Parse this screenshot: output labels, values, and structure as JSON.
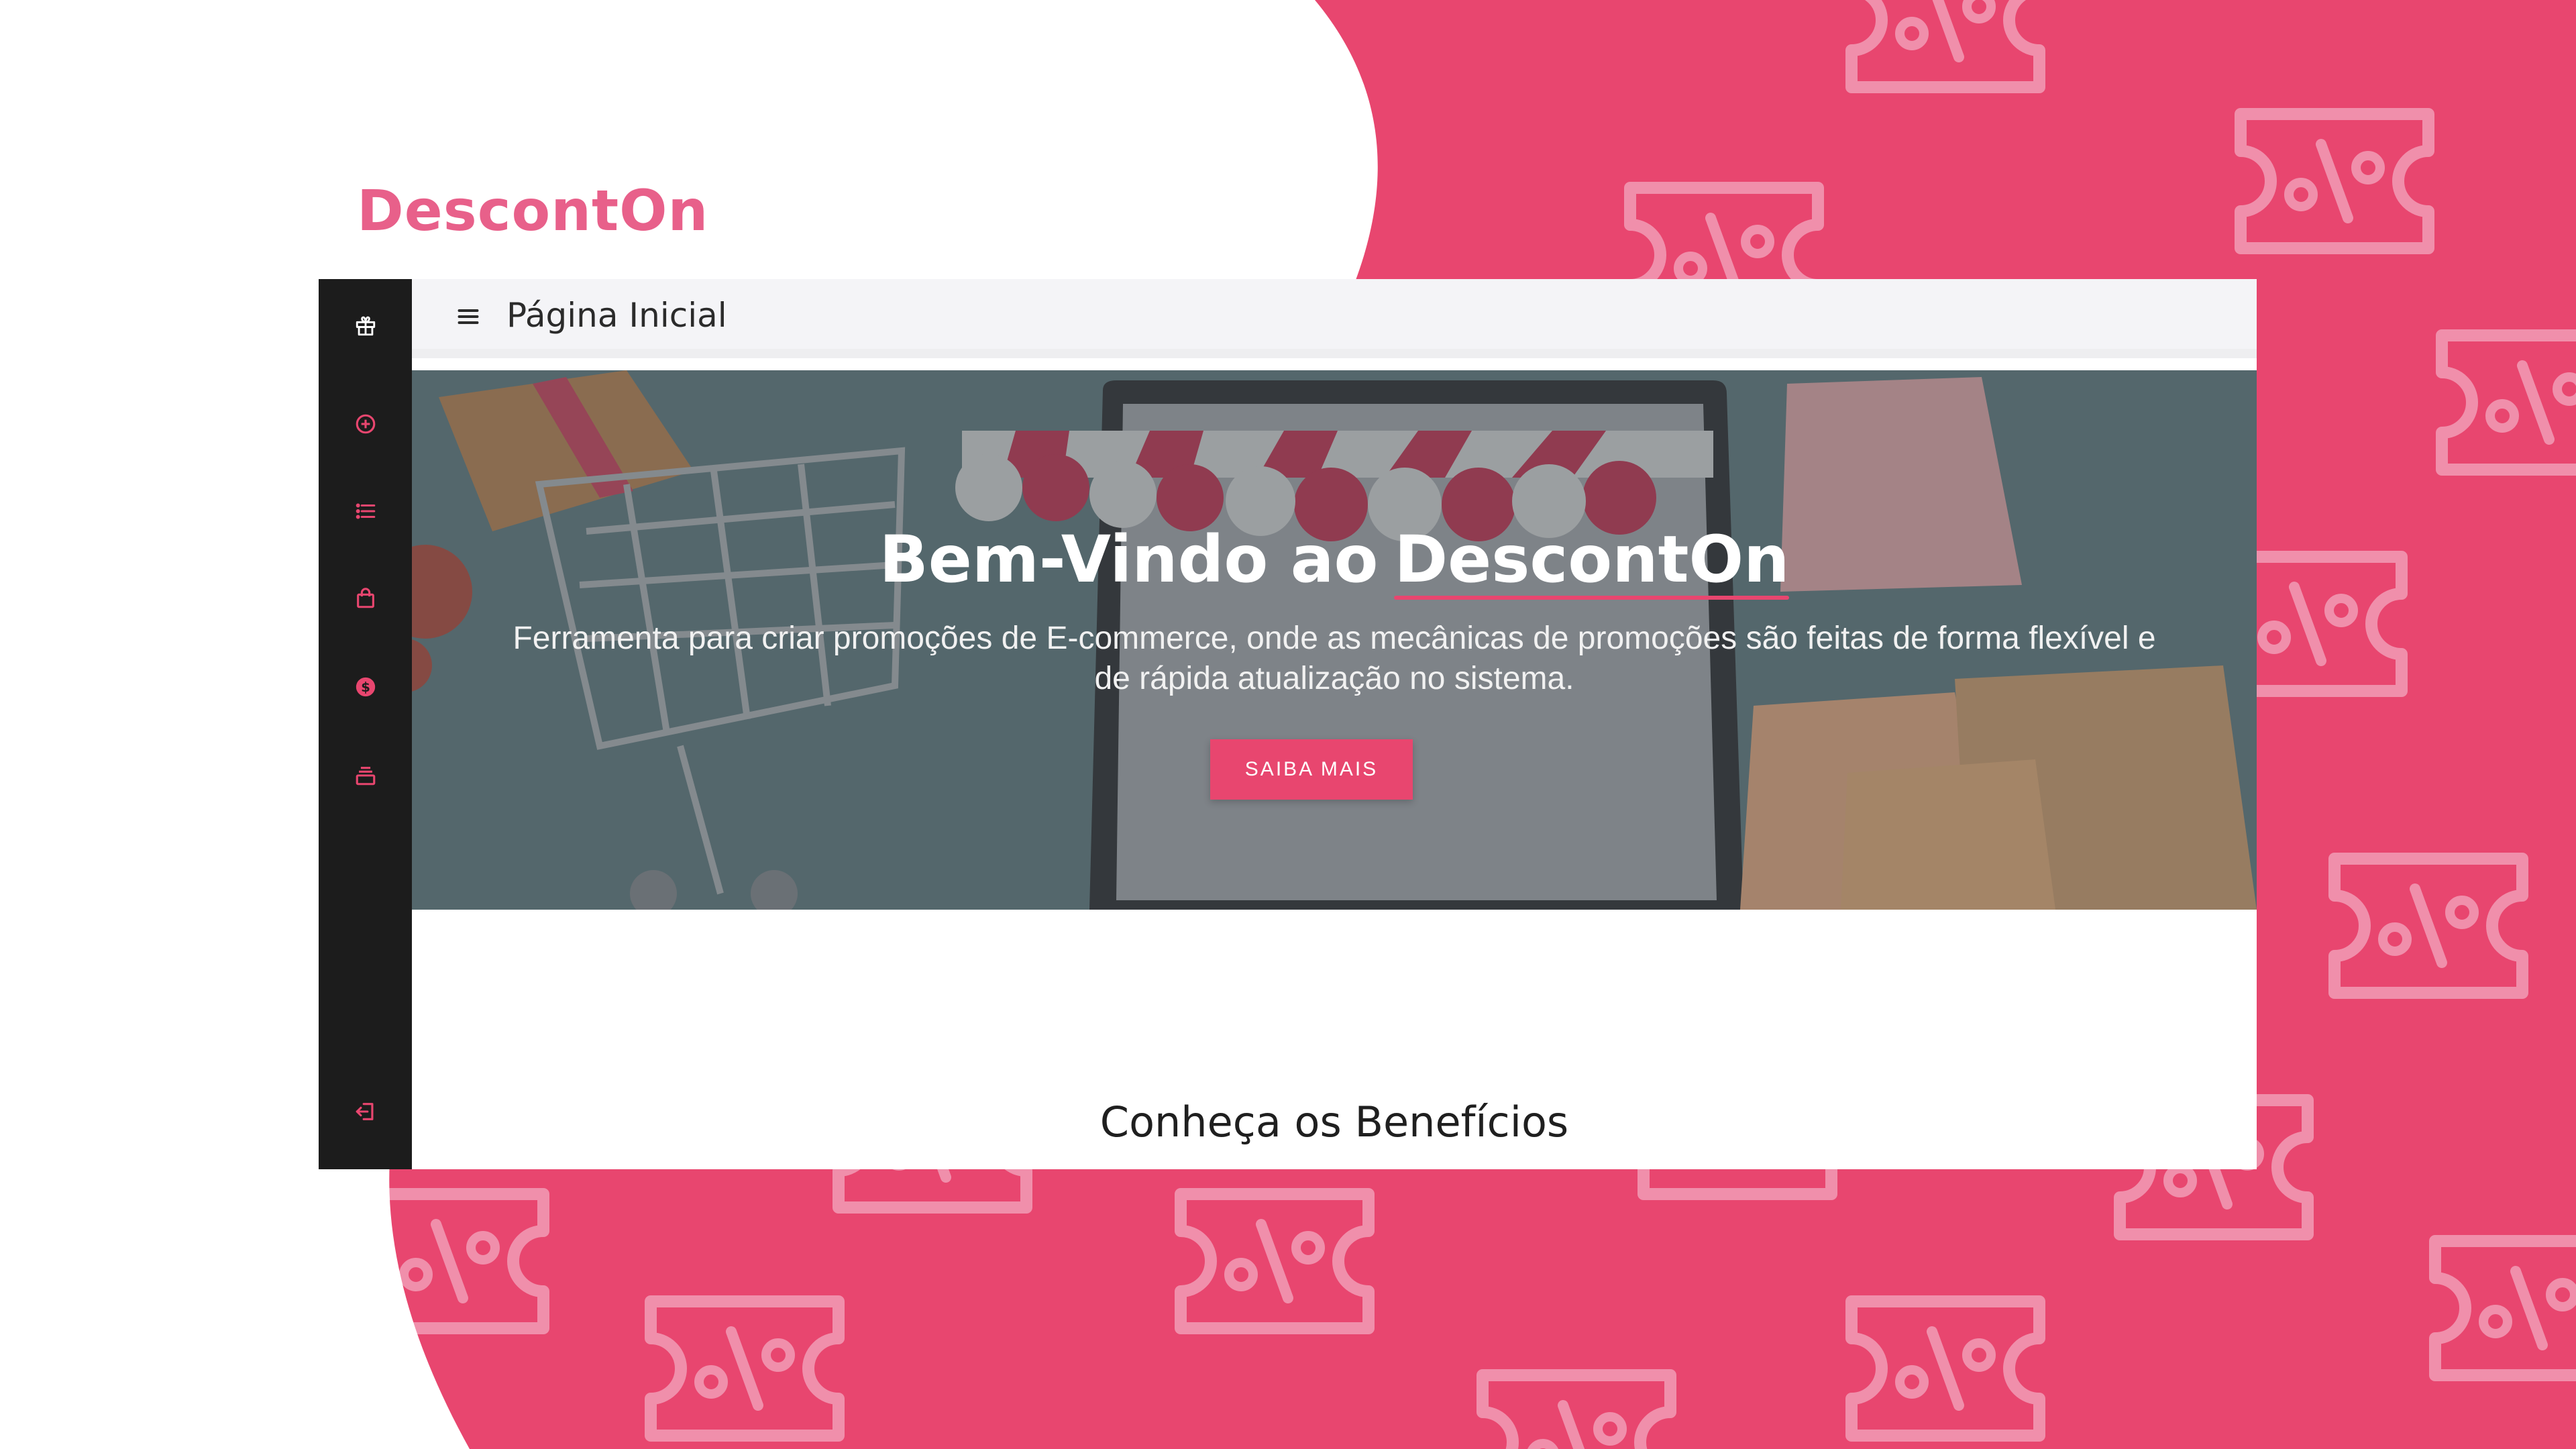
{
  "brand": {
    "name": "DescontOn"
  },
  "colors": {
    "accent": "#e8466f",
    "sidebar": "#1c1c1c",
    "topbar": "#f4f4f7"
  },
  "sidebar": {
    "items": [
      {
        "icon": "gift-icon"
      },
      {
        "icon": "plus-circle-icon"
      },
      {
        "icon": "list-icon"
      },
      {
        "icon": "shopping-bag-icon"
      },
      {
        "icon": "coin-icon"
      },
      {
        "icon": "stack-icon"
      }
    ],
    "logout_icon": "logout-icon"
  },
  "header": {
    "menu_icon": "hamburger-icon",
    "title": "Página Inicial"
  },
  "hero": {
    "title_prefix": "Bem-Vindo ao",
    "title_brand": "DescontOn",
    "subtitle_line1": "Ferramenta para criar promoções de E-commerce, onde as mecânicas de promoções são feitas de forma flexível e",
    "subtitle_line2": "de rápida atualização no sistema.",
    "cta_label": "SAIBA MAIS"
  },
  "section": {
    "benefits_title": "Conheça os Benefícios"
  }
}
